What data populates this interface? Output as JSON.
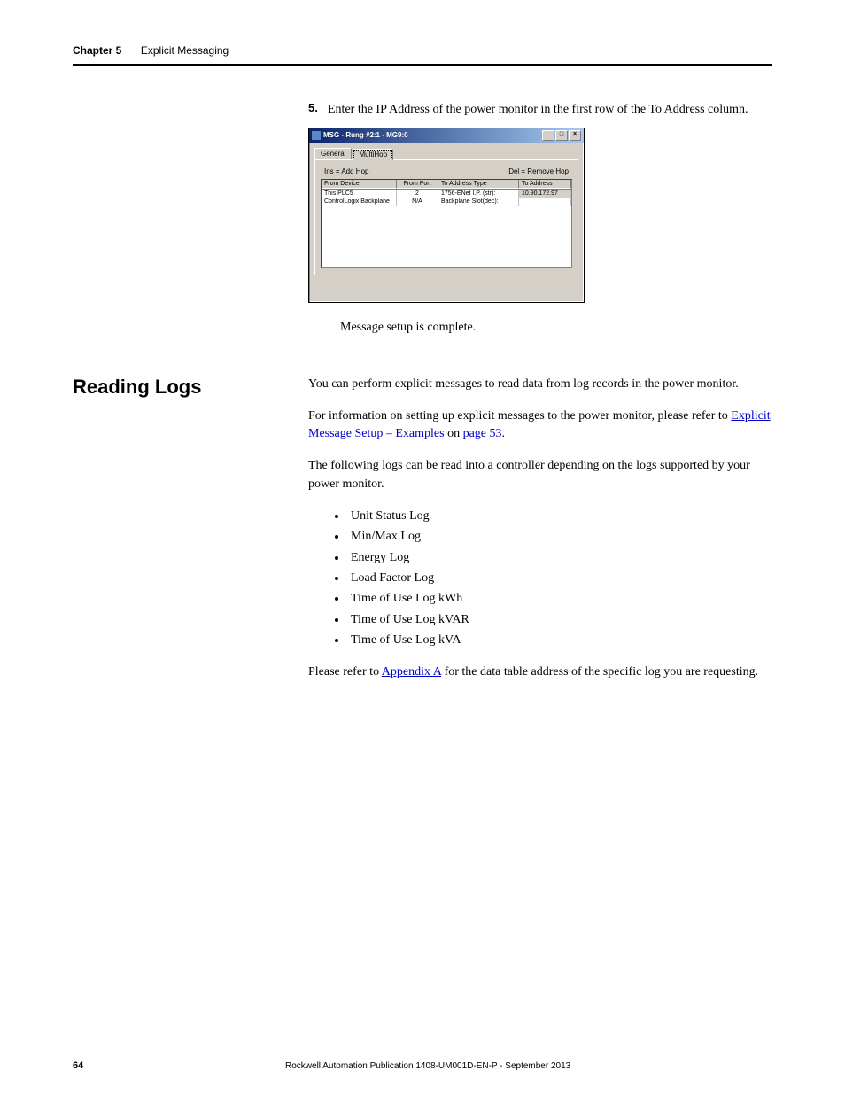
{
  "header": {
    "chapter_label": "Chapter 5",
    "chapter_title": "Explicit Messaging"
  },
  "step": {
    "number": "5.",
    "text": "Enter the IP Address of the power monitor in the first row of the To Address column."
  },
  "dialog": {
    "title": "MSG - Rung #2:1 - MG9:0",
    "tabs": {
      "general": "General",
      "multihop": "MultiHop"
    },
    "hop_labels": {
      "ins": "Ins = Add Hop",
      "del": "Del = Remove Hop"
    },
    "grid_headers": {
      "c1": "From Device",
      "c2": "From Port",
      "c3": "To Address Type",
      "c4": "To Address"
    },
    "rows": [
      {
        "c1": "This PLC5",
        "c2": "2",
        "c3": "1756-ENet I.P. (str):",
        "c4": "10.90.172.97"
      },
      {
        "c1": "ControlLogix Backplane",
        "c2": "N/A",
        "c3": "Backplane Slot(dec):",
        "c4": ""
      }
    ],
    "win_buttons": {
      "min": "_",
      "max": "□",
      "close": "×"
    }
  },
  "after_dialog": "Message setup is complete.",
  "section": {
    "heading": "Reading Logs",
    "p1": "You can perform explicit messages to read data from log records in the power monitor.",
    "p2_a": "For information on setting up explicit messages to the power monitor, please refer to ",
    "p2_link1": "Explicit Message Setup – Examples",
    "p2_b": " on ",
    "p2_link2": "page 53",
    "p2_c": ".",
    "p3": "The following logs can be read into a controller depending on the logs supported by your power monitor.",
    "logs": [
      "Unit Status Log",
      "Min/Max Log",
      "Energy Log",
      "Load Factor Log",
      "Time of Use Log kWh",
      "Time of Use Log kVAR",
      "Time of Use Log kVA"
    ],
    "p4_a": "Please refer to ",
    "p4_link": "Appendix A",
    "p4_b": " for the data table address of the specific log you are requesting."
  },
  "footer": {
    "page": "64",
    "pub": "Rockwell Automation Publication 1408-UM001D-EN-P - September 2013"
  }
}
